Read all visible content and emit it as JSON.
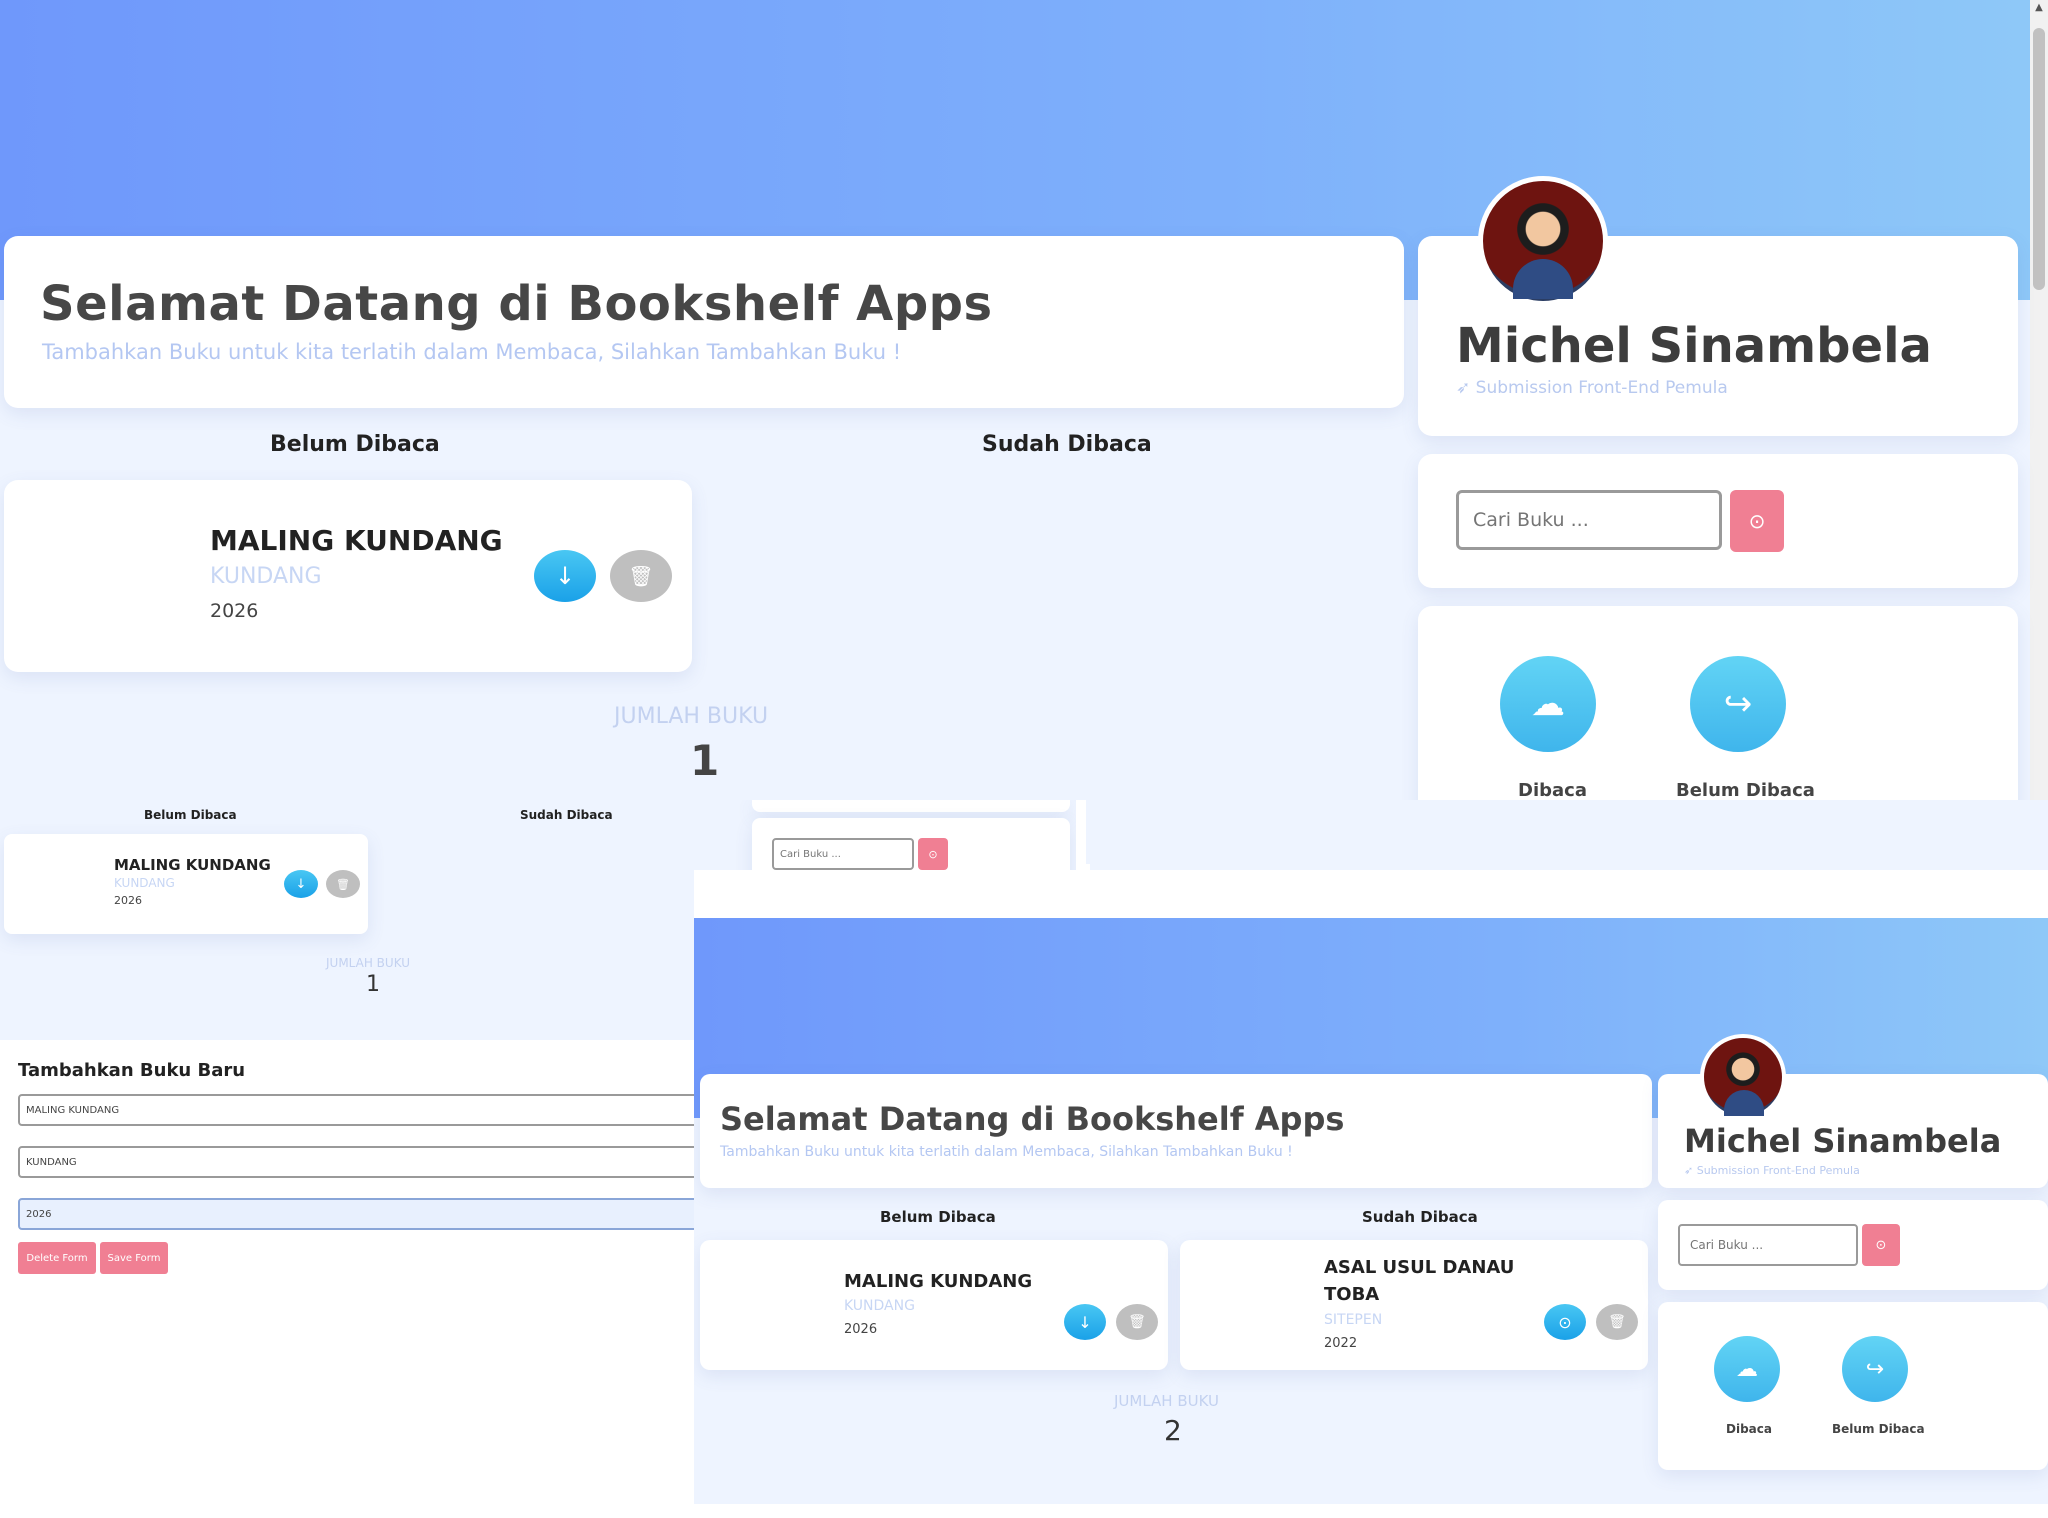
{
  "app": {
    "title": "Selamat Datang di Bookshelf Apps",
    "subtitle": "Tambahkan Buku untuk kita terlatih dalam Membaca, Silahkan Tambahkan Buku !"
  },
  "profile": {
    "name": "Michel Sinambela",
    "subtitle": "Submission Front-End Pemula"
  },
  "search": {
    "placeholder": "Cari Buku ..."
  },
  "columns": {
    "unread": "Belum Dibaca",
    "read": "Sudah Dibaca"
  },
  "count": {
    "label": "JUMLAH BUKU"
  },
  "actions": {
    "read": "Dibaca",
    "unread": "Belum Dibaca"
  },
  "colors": {
    "accent": "#7eb0fb",
    "button_blue": "#1aa1e8",
    "button_pink": "#f07f93",
    "button_grey": "#bfbfbf"
  },
  "icons": [
    "download-icon",
    "trash-icon",
    "search-icon",
    "cloud-upload-icon",
    "share-icon",
    "rocket-icon"
  ],
  "screen1": {
    "books_unread": [
      {
        "title": "MALING KUNDANG",
        "author": "KUNDANG",
        "year": "2026"
      }
    ],
    "count": "1"
  },
  "screen2": {
    "books_unread": [
      {
        "title": "MALING KUNDANG",
        "author": "KUNDANG",
        "year": "2026"
      }
    ],
    "count": "1",
    "form": {
      "heading": "Tambahkan Buku Baru",
      "title_value": "MALING KUNDANG",
      "author_value": "KUNDANG",
      "year_value": "2026",
      "delete_label": "Delete Form",
      "save_label": "Save Form"
    }
  },
  "screen3": {
    "books_unread": [
      {
        "title": "MALING KUNDANG",
        "author": "KUNDANG",
        "year": "2026"
      }
    ],
    "books_read": [
      {
        "title": "ASAL USUL DANAU TOBA",
        "author": "SITEPEN",
        "year": "2022"
      }
    ],
    "count": "2"
  }
}
